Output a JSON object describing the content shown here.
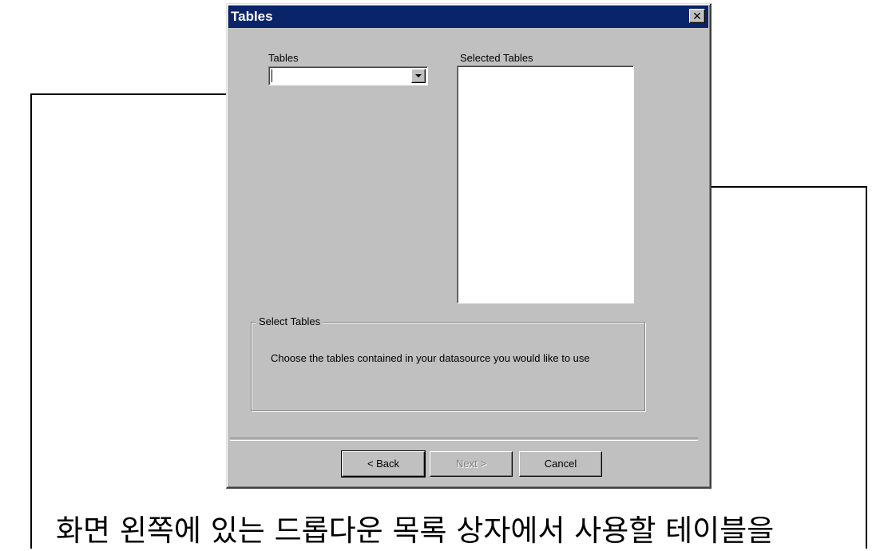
{
  "dialog": {
    "title": "Tables",
    "close_glyph": "✕",
    "tables_label": "Tables",
    "tables_combo_value": "",
    "selected_tables_label": "Selected Tables",
    "selected_tables_items": [],
    "group": {
      "legend": "Select Tables",
      "description": "Choose the tables contained in your datasource you would like to use"
    },
    "buttons": {
      "back": "< Back",
      "next": "Next >",
      "cancel": "Cancel"
    }
  },
  "caption": "화면 왼쪽에 있는 드롭다운 목록 상자에서 사용할 테이블을",
  "colors": {
    "dialog_bg": "#c0c0c0",
    "titlebar_bg": "#0a246a",
    "titlebar_text": "#ffffff"
  },
  "icons": [
    "close-icon",
    "chevron-down-icon"
  ]
}
